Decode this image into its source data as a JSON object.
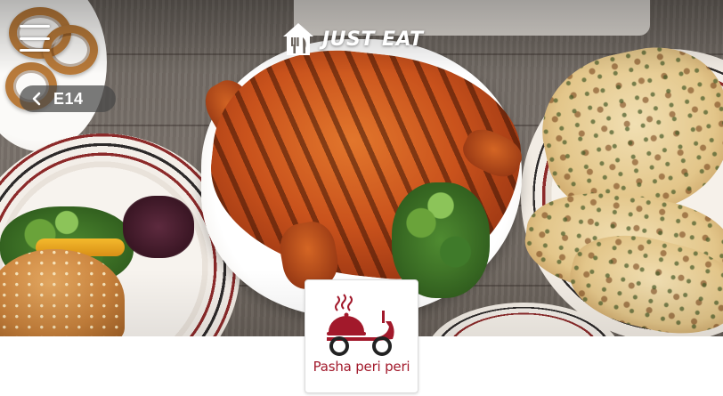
{
  "header": {
    "brand_name": "JUST EAT",
    "brand_color": "#ffffff",
    "menu_icon": "hamburger-menu-icon",
    "logo_icon": "house-fork-knife-icon"
  },
  "location": {
    "postcode": "E14",
    "back_icon": "chevron-left-icon"
  },
  "restaurant": {
    "name": "Pasha peri peri",
    "logo_icon": "delivery-scooter-cloche-icon",
    "accent_color": "#a2192b"
  },
  "hero": {
    "image_subject": "food-banner"
  }
}
